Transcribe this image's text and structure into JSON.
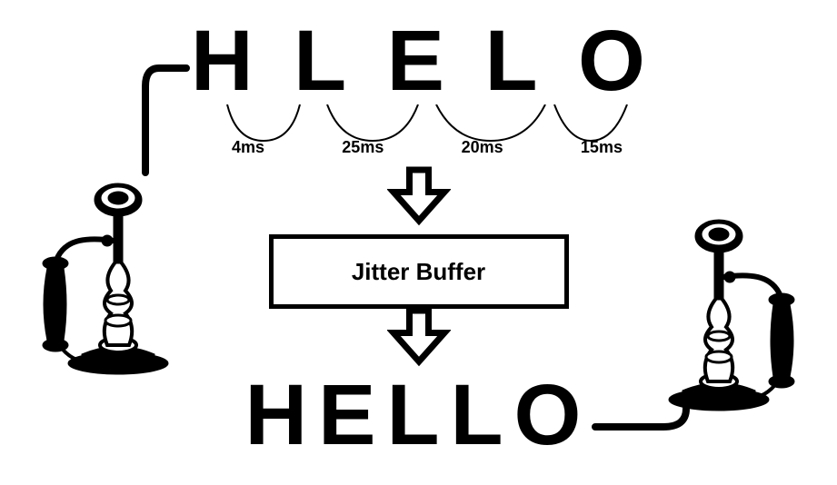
{
  "jumbled_letters": [
    "H",
    "L",
    "E",
    "L",
    "O"
  ],
  "timings": [
    "4ms",
    "25ms",
    "20ms",
    "15ms"
  ],
  "buffer_label": "Jitter Buffer",
  "ordered_word": "HELLO"
}
